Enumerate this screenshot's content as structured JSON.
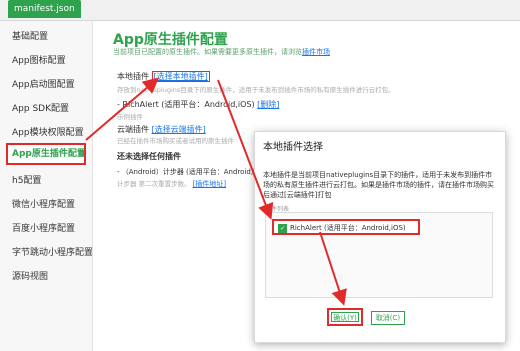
{
  "tab": {
    "label": "manifest.json"
  },
  "sidebar": {
    "items": [
      {
        "label": "基础配置"
      },
      {
        "label": "App图标配置"
      },
      {
        "label": "App启动图配置"
      },
      {
        "label": "App SDK配置"
      },
      {
        "label": "App模块权限配置"
      },
      {
        "label": "App原生插件配置"
      },
      {
        "label": "h5配置"
      },
      {
        "label": "微信小程序配置"
      },
      {
        "label": "百度小程序配置"
      },
      {
        "label": "字节跳动小程序配置"
      },
      {
        "label": "源码视图"
      }
    ]
  },
  "main": {
    "title": "App原生插件配置",
    "subtitle": "当前项目已配置的原生插件。如果需要更多原生插件，请浏览",
    "subtitle_link": "插件市场",
    "local_label": "本地插件",
    "local_link": "[选择本地插件]",
    "local_hint": "存放到nativeplugins目录下的原生插件，适用于未发布到插件市场的私有原生插件进行云打包。",
    "richalert_text": "- RichAlert (适用平台：Android,iOS)",
    "delete_link": "[删除]",
    "richalert_hint": "示例插件",
    "cloud_label": "云端插件",
    "cloud_link": "[选择云端插件]",
    "cloud_hint": "已经在插件市场购买或者试用的原生插件",
    "no_plugin": "还未选择任何插件",
    "android_text": "- （Android）计步器 (适用平台：Android,iOS)",
    "android_hint": "计步器 第二次重置步数。",
    "plugin_link": "[插件地址]"
  },
  "dialog": {
    "title": "本地插件选择",
    "desc": "本地插件是当前项目nativeplugins目录下的插件，适用于未发布到插件市场的私有原生插件进行云打包。如果是插件市场的插件，请在插件市场购买后通过[云端插件]打包",
    "list_label": "插件列表",
    "item_label": "RichAlert (适用平台：Android,iOS)",
    "ok": "确认(Y)",
    "cancel": "取消(C)"
  },
  "colors": {
    "accent": "#2fa24e",
    "highlight": "#e12b2b",
    "link": "#1a73e8"
  }
}
